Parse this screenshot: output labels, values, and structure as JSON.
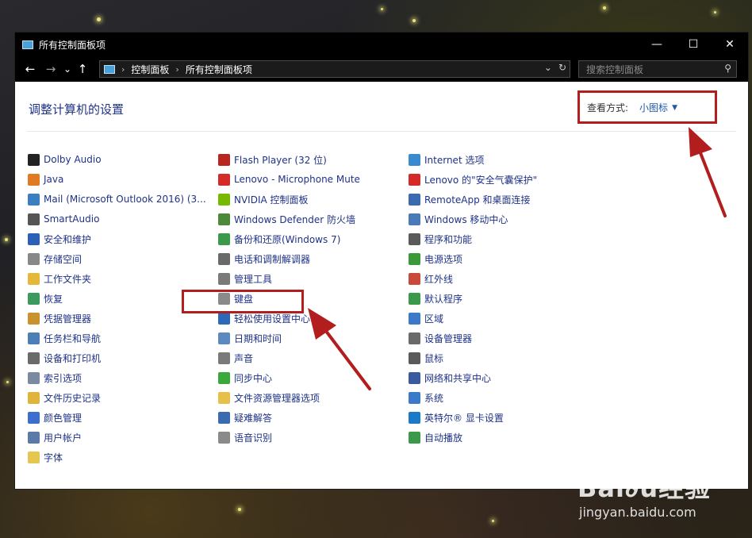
{
  "window": {
    "title": "所有控制面板项"
  },
  "titlebar_buttons": {
    "minimize": "—",
    "maximize": "☐",
    "close": "✕"
  },
  "nav": {
    "back": "←",
    "forward": "→",
    "recent": "⌄",
    "up": "↑",
    "breadcrumb": [
      "控制面板",
      "所有控制面板项"
    ],
    "breadcrumb_sep": "›",
    "dropdown": "⌄",
    "refresh": "↻",
    "search_placeholder": "搜索控制面板",
    "search_icon": "⚲"
  },
  "content": {
    "heading": "调整计算机的设置",
    "view_by_label": "查看方式:",
    "view_by_value": "小图标",
    "view_by_caret": "▼"
  },
  "columns": [
    [
      {
        "label": "Dolby Audio",
        "icon": "dolby-icon",
        "color": "#222222"
      },
      {
        "label": "Java",
        "icon": "java-icon",
        "color": "#e07b22"
      },
      {
        "label": "Mail (Microsoft Outlook 2016) (3...",
        "icon": "mail-icon",
        "color": "#3a7fc2"
      },
      {
        "label": "SmartAudio",
        "icon": "smartaudio-icon",
        "color": "#555555"
      },
      {
        "label": "安全和维护",
        "icon": "flag-icon",
        "color": "#2b5fb8"
      },
      {
        "label": "存储空间",
        "icon": "storage-icon",
        "color": "#888888"
      },
      {
        "label": "工作文件夹",
        "icon": "work-folder-icon",
        "color": "#e6b83a"
      },
      {
        "label": "恢复",
        "icon": "recovery-icon",
        "color": "#3c9a5f"
      },
      {
        "label": "凭据管理器",
        "icon": "credential-icon",
        "color": "#c9922e"
      },
      {
        "label": "任务栏和导航",
        "icon": "taskbar-icon",
        "color": "#4a7fb8"
      },
      {
        "label": "设备和打印机",
        "icon": "printer-icon",
        "color": "#6a6a6a"
      },
      {
        "label": "索引选项",
        "icon": "index-icon",
        "color": "#7a8aa0"
      },
      {
        "label": "文件历史记录",
        "icon": "file-history-icon",
        "color": "#e0b43a"
      },
      {
        "label": "颜色管理",
        "icon": "color-icon",
        "color": "#3a6fd0"
      },
      {
        "label": "用户帐户",
        "icon": "user-icon",
        "color": "#5a7aa8"
      },
      {
        "label": "字体",
        "icon": "font-icon",
        "color": "#e6c550"
      }
    ],
    [
      {
        "label": "Flash Player (32 位)",
        "icon": "flash-icon",
        "color": "#b8261e"
      },
      {
        "label": "Lenovo - Microphone Mute",
        "icon": "mic-mute-icon",
        "color": "#d42a2a"
      },
      {
        "label": "NVIDIA 控制面板",
        "icon": "nvidia-icon",
        "color": "#76b900"
      },
      {
        "label": "Windows Defender 防火墙",
        "icon": "firewall-icon",
        "color": "#4a8a3a"
      },
      {
        "label": "备份和还原(Windows 7)",
        "icon": "backup-icon",
        "color": "#3a9a4a"
      },
      {
        "label": "电话和调制解调器",
        "icon": "modem-icon",
        "color": "#6a6a6a"
      },
      {
        "label": "管理工具",
        "icon": "admin-tools-icon",
        "color": "#7a7a7a"
      },
      {
        "label": "键盘",
        "icon": "keyboard-icon",
        "color": "#8a8a8a"
      },
      {
        "label": "轻松使用设置中心",
        "icon": "ease-access-icon",
        "color": "#2a6ab8"
      },
      {
        "label": "日期和时间",
        "icon": "datetime-icon",
        "color": "#5a8ac0"
      },
      {
        "label": "声音",
        "icon": "sound-icon",
        "color": "#7a7a7a"
      },
      {
        "label": "同步中心",
        "icon": "sync-icon",
        "color": "#3aa83a"
      },
      {
        "label": "文件资源管理器选项",
        "icon": "folder-options-icon",
        "color": "#e6c04a"
      },
      {
        "label": "疑难解答",
        "icon": "troubleshoot-icon",
        "color": "#3a6ab0"
      },
      {
        "label": "语音识别",
        "icon": "speech-icon",
        "color": "#8a8a8a"
      }
    ],
    [
      {
        "label": "Internet 选项",
        "icon": "internet-icon",
        "color": "#3a8ad0"
      },
      {
        "label": "Lenovo 的\"安全气囊保护\"",
        "icon": "airbag-icon",
        "color": "#d42a2a"
      },
      {
        "label": "RemoteApp 和桌面连接",
        "icon": "remoteapp-icon",
        "color": "#3a6ab0"
      },
      {
        "label": "Windows 移动中心",
        "icon": "mobility-icon",
        "color": "#4a7ab8"
      },
      {
        "label": "程序和功能",
        "icon": "programs-icon",
        "color": "#5a5a5a"
      },
      {
        "label": "电源选项",
        "icon": "power-icon",
        "color": "#3a9a3a"
      },
      {
        "label": "红外线",
        "icon": "infrared-icon",
        "color": "#c84a3a"
      },
      {
        "label": "默认程序",
        "icon": "default-programs-icon",
        "color": "#3a9a4a"
      },
      {
        "label": "区域",
        "icon": "region-icon",
        "color": "#3a7ac8"
      },
      {
        "label": "设备管理器",
        "icon": "device-manager-icon",
        "color": "#6a6a6a"
      },
      {
        "label": "鼠标",
        "icon": "mouse-icon",
        "color": "#5a5a5a"
      },
      {
        "label": "网络和共享中心",
        "icon": "network-icon",
        "color": "#3a5aa0"
      },
      {
        "label": "系统",
        "icon": "system-icon",
        "color": "#3a7ac8"
      },
      {
        "label": "英特尔® 显卡设置",
        "icon": "intel-graphics-icon",
        "color": "#1a7ac8"
      },
      {
        "label": "自动播放",
        "icon": "autoplay-icon",
        "color": "#3a9a4a"
      }
    ]
  ],
  "watermark": {
    "logo": "Bai∂u经验",
    "url": "jingyan.baidu.com"
  }
}
